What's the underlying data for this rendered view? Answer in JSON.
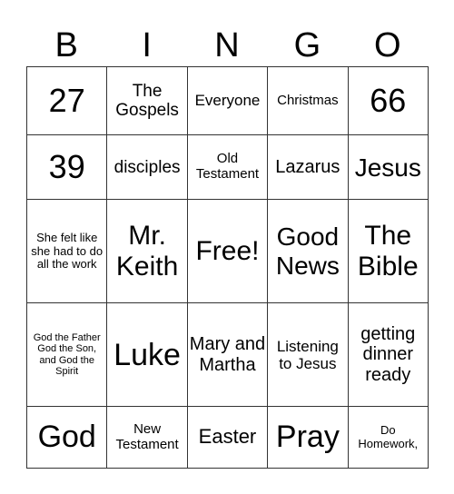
{
  "header": [
    "B",
    "I",
    "N",
    "G",
    "O"
  ],
  "cells": [
    [
      {
        "t": "27",
        "s": 36
      },
      {
        "t": "The Gospels",
        "s": 19
      },
      {
        "t": "Everyone",
        "s": 17
      },
      {
        "t": "Christmas",
        "s": 15
      },
      {
        "t": "66",
        "s": 36
      }
    ],
    [
      {
        "t": "39",
        "s": 36
      },
      {
        "t": "disciples",
        "s": 19
      },
      {
        "t": "Old Testament",
        "s": 15
      },
      {
        "t": "Lazarus",
        "s": 20
      },
      {
        "t": "Jesus",
        "s": 28
      }
    ],
    [
      {
        "t": "She felt like she had to do all the work",
        "s": 13
      },
      {
        "t": "Mr. Keith",
        "s": 30
      },
      {
        "t": "Free!",
        "s": 30
      },
      {
        "t": "Good News",
        "s": 28
      },
      {
        "t": "The Bible",
        "s": 30
      }
    ],
    [
      {
        "t": "God the Father God the Son, and God the Spirit",
        "s": 11
      },
      {
        "t": "Luke",
        "s": 34
      },
      {
        "t": "Mary and Martha",
        "s": 20
      },
      {
        "t": "Listening to Jesus",
        "s": 17
      },
      {
        "t": "getting dinner ready",
        "s": 20
      }
    ],
    [
      {
        "t": "God",
        "s": 34
      },
      {
        "t": "New Testament",
        "s": 15
      },
      {
        "t": "Easter",
        "s": 22
      },
      {
        "t": "Pray",
        "s": 34
      },
      {
        "t": "Do Homework,",
        "s": 13
      }
    ]
  ]
}
